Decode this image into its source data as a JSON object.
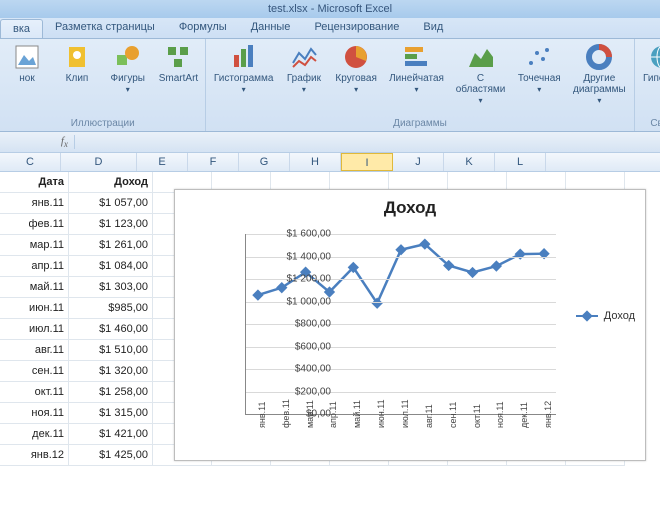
{
  "title": "test.xlsx - Microsoft Excel",
  "tabs": {
    "active": "вка",
    "items": [
      "вка",
      "Разметка страницы",
      "Формулы",
      "Данные",
      "Рецензирование",
      "Вид"
    ]
  },
  "ribbon": {
    "illustrations": {
      "name": "Иллюстрации",
      "buttons": [
        {
          "label": "нок",
          "icon": "picture"
        },
        {
          "label": "Клип",
          "icon": "clip"
        },
        {
          "label": "Фигуры",
          "icon": "shapes",
          "dd": true
        },
        {
          "label": "SmartArt",
          "icon": "smartart"
        }
      ]
    },
    "charts": {
      "name": "Диаграммы",
      "buttons": [
        {
          "label": "Гистограмма",
          "icon": "bar",
          "dd": true
        },
        {
          "label": "График",
          "icon": "line",
          "dd": true
        },
        {
          "label": "Круговая",
          "icon": "pie",
          "dd": true
        },
        {
          "label": "Линейчатая",
          "icon": "hbar",
          "dd": true
        },
        {
          "label": "С\nобластями",
          "icon": "area",
          "dd": true
        },
        {
          "label": "Точечная",
          "icon": "scatter",
          "dd": true
        },
        {
          "label": "Другие\nдиаграммы",
          "icon": "donut",
          "dd": true
        }
      ]
    },
    "links": {
      "name": "Связ",
      "buttons": [
        {
          "label": "Гиперсс",
          "icon": "hyperlink"
        }
      ]
    }
  },
  "cols": [
    "C",
    "D",
    "E",
    "F",
    "G",
    "H",
    "I",
    "J",
    "K",
    "L"
  ],
  "selectedCol": "I",
  "data": {
    "header": {
      "c": "Дата",
      "d": "Доход"
    },
    "rows": [
      {
        "c": "янв.11",
        "d": "$1 057,00"
      },
      {
        "c": "фев.11",
        "d": "$1 123,00"
      },
      {
        "c": "мар.11",
        "d": "$1 261,00"
      },
      {
        "c": "апр.11",
        "d": "$1 084,00"
      },
      {
        "c": "май.11",
        "d": "$1 303,00"
      },
      {
        "c": "июн.11",
        "d": "$985,00"
      },
      {
        "c": "июл.11",
        "d": "$1 460,00"
      },
      {
        "c": "авг.11",
        "d": "$1 510,00"
      },
      {
        "c": "сен.11",
        "d": "$1 320,00"
      },
      {
        "c": "окт.11",
        "d": "$1 258,00"
      },
      {
        "c": "ноя.11",
        "d": "$1 315,00"
      },
      {
        "c": "дек.11",
        "d": "$1 421,00"
      },
      {
        "c": "янв.12",
        "d": "$1 425,00"
      }
    ]
  },
  "chart_data": {
    "type": "line",
    "title": "Доход",
    "legend": "Доход",
    "ylim": [
      0,
      1600
    ],
    "ystep": 200,
    "yformat": "dollar",
    "categories": [
      "янв.11",
      "фев.11",
      "мар.11",
      "апр.11",
      "май.11",
      "июн.11",
      "июл.11",
      "авг.11",
      "сен.11",
      "окт.11",
      "ноя.11",
      "дек.11",
      "янв.12"
    ],
    "series": [
      {
        "name": "Доход",
        "values": [
          1057,
          1123,
          1261,
          1084,
          1303,
          985,
          1460,
          1510,
          1320,
          1258,
          1315,
          1421,
          1425
        ]
      }
    ]
  }
}
